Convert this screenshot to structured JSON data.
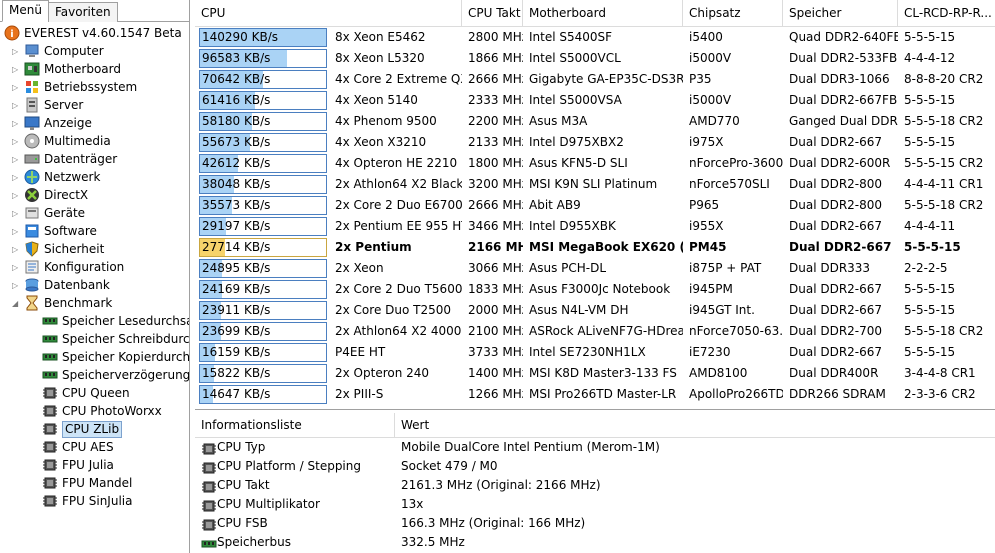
{
  "tabs": [
    "Menü",
    "Favoriten"
  ],
  "tree": [
    {
      "label": "EVEREST v4.60.1547 Beta",
      "icon": "everest-info-icon",
      "level": 0,
      "exp": ""
    },
    {
      "label": "Computer",
      "icon": "computer-icon",
      "level": 1,
      "exp": "▷"
    },
    {
      "label": "Motherboard",
      "icon": "motherboard-icon",
      "level": 1,
      "exp": "▷"
    },
    {
      "label": "Betriebssystem",
      "icon": "windows-icon",
      "level": 1,
      "exp": "▷"
    },
    {
      "label": "Server",
      "icon": "server-icon",
      "level": 1,
      "exp": "▷"
    },
    {
      "label": "Anzeige",
      "icon": "display-icon",
      "level": 1,
      "exp": "▷"
    },
    {
      "label": "Multimedia",
      "icon": "multimedia-icon",
      "level": 1,
      "exp": "▷"
    },
    {
      "label": "Datenträger",
      "icon": "drive-icon",
      "level": 1,
      "exp": "▷"
    },
    {
      "label": "Netzwerk",
      "icon": "network-icon",
      "level": 1,
      "exp": "▷"
    },
    {
      "label": "DirectX",
      "icon": "directx-icon",
      "level": 1,
      "exp": "▷"
    },
    {
      "label": "Geräte",
      "icon": "devices-icon",
      "level": 1,
      "exp": "▷"
    },
    {
      "label": "Software",
      "icon": "software-icon",
      "level": 1,
      "exp": "▷"
    },
    {
      "label": "Sicherheit",
      "icon": "security-shield-icon",
      "level": 1,
      "exp": "▷"
    },
    {
      "label": "Konfiguration",
      "icon": "configuration-icon",
      "level": 1,
      "exp": "▷"
    },
    {
      "label": "Datenbank",
      "icon": "database-icon",
      "level": 1,
      "exp": "▷"
    },
    {
      "label": "Benchmark",
      "icon": "hourglass-icon",
      "level": 1,
      "exp": "◢"
    },
    {
      "label": "Speicher Lesedurchsatz",
      "icon": "memory-icon",
      "level": 2,
      "exp": ""
    },
    {
      "label": "Speicher Schreibdurchsatz",
      "icon": "memory-icon",
      "level": 2,
      "exp": ""
    },
    {
      "label": "Speicher Kopierdurchsatz",
      "icon": "memory-icon",
      "level": 2,
      "exp": ""
    },
    {
      "label": "Speicherverzögerung",
      "icon": "memory-icon",
      "level": 2,
      "exp": ""
    },
    {
      "label": "CPU Queen",
      "icon": "cpu-icon",
      "level": 2,
      "exp": ""
    },
    {
      "label": "CPU PhotoWorxx",
      "icon": "cpu-icon",
      "level": 2,
      "exp": ""
    },
    {
      "label": "CPU ZLib",
      "icon": "cpu-icon",
      "level": 2,
      "exp": "",
      "selected": true
    },
    {
      "label": "CPU AES",
      "icon": "cpu-icon",
      "level": 2,
      "exp": ""
    },
    {
      "label": "FPU Julia",
      "icon": "cpu-icon",
      "level": 2,
      "exp": ""
    },
    {
      "label": "FPU Mandel",
      "icon": "cpu-icon",
      "level": 2,
      "exp": ""
    },
    {
      "label": "FPU SinJulia",
      "icon": "cpu-icon",
      "level": 2,
      "exp": ""
    }
  ],
  "table": {
    "columns": [
      "CPU",
      "CPU Takt",
      "Motherboard",
      "Chipsatz",
      "Speicher",
      "CL-RCD-RP-R..."
    ],
    "max_value": 140290,
    "rows": [
      {
        "value": "140290 KB/s",
        "num": 140290,
        "cpu": "8x Xeon E5462",
        "takt": "2800 MHz",
        "mb": "Intel S5400SF",
        "chip": "i5400",
        "mem": "Quad DDR2-640FB",
        "cl": "5-5-5-15"
      },
      {
        "value": "96583 KB/s",
        "num": 96583,
        "cpu": "8x Xeon L5320",
        "takt": "1866 MHz",
        "mb": "Intel S5000VCL",
        "chip": "i5000V",
        "mem": "Dual DDR2-533FB",
        "cl": "4-4-4-12"
      },
      {
        "value": "70642 KB/s",
        "num": 70642,
        "cpu": "4x Core 2 Extreme QX...",
        "takt": "2666 MHz",
        "mb": "Gigabyte GA-EP35C-DS3R",
        "chip": "P35",
        "mem": "Dual DDR3-1066",
        "cl": "8-8-8-20 CR2"
      },
      {
        "value": "61416 KB/s",
        "num": 61416,
        "cpu": "4x Xeon 5140",
        "takt": "2333 MHz",
        "mb": "Intel S5000VSA",
        "chip": "i5000V",
        "mem": "Dual DDR2-667FB",
        "cl": "5-5-5-15"
      },
      {
        "value": "58180 KB/s",
        "num": 58180,
        "cpu": "4x Phenom 9500",
        "takt": "2200 MHz",
        "mb": "Asus M3A",
        "chip": "AMD770",
        "mem": "Ganged Dual DDR...",
        "cl": "5-5-5-18 CR2"
      },
      {
        "value": "55673 KB/s",
        "num": 55673,
        "cpu": "4x Xeon X3210",
        "takt": "2133 MHz",
        "mb": "Intel D975XBX2",
        "chip": "i975X",
        "mem": "Dual DDR2-667",
        "cl": "5-5-5-15"
      },
      {
        "value": "42612 KB/s",
        "num": 42612,
        "cpu": "4x Opteron HE 2210",
        "takt": "1800 MHz",
        "mb": "Asus KFN5-D SLI",
        "chip": "nForcePro-3600",
        "mem": "Dual DDR2-600R",
        "cl": "5-5-5-15 CR2"
      },
      {
        "value": "38048 KB/s",
        "num": 38048,
        "cpu": "2x Athlon64 X2 Black ...",
        "takt": "3200 MHz",
        "mb": "MSI K9N SLI Platinum",
        "chip": "nForce570SLI",
        "mem": "Dual DDR2-800",
        "cl": "4-4-4-11 CR1"
      },
      {
        "value": "35573 KB/s",
        "num": 35573,
        "cpu": "2x Core 2 Duo E6700",
        "takt": "2666 MHz",
        "mb": "Abit AB9",
        "chip": "P965",
        "mem": "Dual DDR2-800",
        "cl": "5-5-5-18 CR2"
      },
      {
        "value": "29197 KB/s",
        "num": 29197,
        "cpu": "2x Pentium EE 955 HT",
        "takt": "3466 MHz",
        "mb": "Intel D955XBK",
        "chip": "i955X",
        "mem": "Dual DDR2-667",
        "cl": "4-4-4-11"
      },
      {
        "value": "27714 KB/s",
        "num": 27714,
        "cpu": "2x Pentium",
        "takt": "2166 MHz",
        "mb": "MSI MegaBook EX620 (...",
        "chip": "PM45",
        "mem": "Dual DDR2-667",
        "cl": "5-5-5-15",
        "highlight": true
      },
      {
        "value": "24895 KB/s",
        "num": 24895,
        "cpu": "2x Xeon",
        "takt": "3066 MHz",
        "mb": "Asus PCH-DL",
        "chip": "i875P + PAT",
        "mem": "Dual DDR333",
        "cl": "2-2-2-5"
      },
      {
        "value": "24169 KB/s",
        "num": 24169,
        "cpu": "2x Core 2 Duo T5600",
        "takt": "1833 MHz",
        "mb": "Asus F3000Jc Notebook",
        "chip": "i945PM",
        "mem": "Dual DDR2-667",
        "cl": "5-5-5-15"
      },
      {
        "value": "23911 KB/s",
        "num": 23911,
        "cpu": "2x Core Duo T2500",
        "takt": "2000 MHz",
        "mb": "Asus N4L-VM DH",
        "chip": "i945GT Int.",
        "mem": "Dual DDR2-667",
        "cl": "5-5-5-15"
      },
      {
        "value": "23699 KB/s",
        "num": 23699,
        "cpu": "2x Athlon64 X2 4000+",
        "takt": "2100 MHz",
        "mb": "ASRock ALiveNF7G-HDrea...",
        "chip": "nForce7050-63...",
        "mem": "Dual DDR2-700",
        "cl": "5-5-5-18 CR2"
      },
      {
        "value": "16159 KB/s",
        "num": 16159,
        "cpu": "P4EE HT",
        "takt": "3733 MHz",
        "mb": "Intel SE7230NH1LX",
        "chip": "iE7230",
        "mem": "Dual DDR2-667",
        "cl": "5-5-5-15"
      },
      {
        "value": "15822 KB/s",
        "num": 15822,
        "cpu": "2x Opteron 240",
        "takt": "1400 MHz",
        "mb": "MSI K8D Master3-133 FS",
        "chip": "AMD8100",
        "mem": "Dual DDR400R",
        "cl": "3-4-4-8 CR1"
      },
      {
        "value": "14647 KB/s",
        "num": 14647,
        "cpu": "2x PIII-S",
        "takt": "1266 MHz",
        "mb": "MSI Pro266TD Master-LR",
        "chip": "ApolloPro266TD",
        "mem": "DDR266 SDRAM",
        "cl": "2-3-3-6 CR2"
      }
    ]
  },
  "info": {
    "columns": [
      "Informationsliste",
      "Wert"
    ],
    "rows": [
      {
        "key": "CPU Typ",
        "value": "Mobile DualCore Intel Pentium  (Merom-1M)",
        "icon": "cpu-icon"
      },
      {
        "key": "CPU Platform / Stepping",
        "value": "Socket 479 / M0",
        "icon": "cpu-icon"
      },
      {
        "key": "CPU Takt",
        "value": "2161.3 MHz  (Original: 2166 MHz)",
        "icon": "cpu-icon"
      },
      {
        "key": "CPU Multiplikator",
        "value": "13x",
        "icon": "cpu-icon"
      },
      {
        "key": "CPU FSB",
        "value": "166.3 MHz  (Original: 166 MHz)",
        "icon": "cpu-icon"
      },
      {
        "key": "Speicherbus",
        "value": "332.5 MHz",
        "icon": "memory-icon"
      }
    ]
  }
}
